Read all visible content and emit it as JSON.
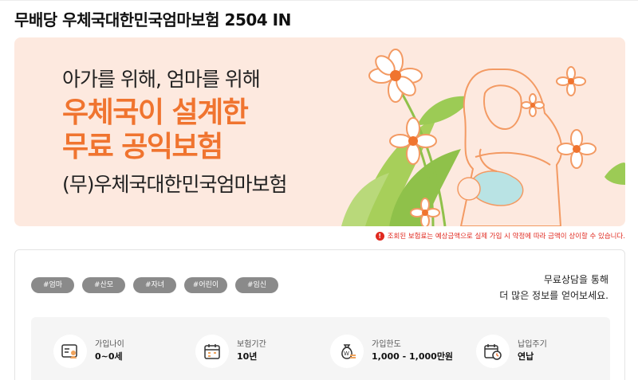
{
  "page": {
    "title": "무배당 우체국대한민국엄마보험 2504 IN"
  },
  "banner": {
    "subtitle": "아가를 위해, 엄마를 위해",
    "headline_line1": "우체국이 설계한",
    "headline_line2": "무료 공익보험",
    "product": "(무)우체국대한민국엄마보험",
    "accent_color": "#f0742f",
    "background_color": "#fde9df"
  },
  "notice": {
    "icon": "exclamation-icon",
    "text": "조회된 보험료는 예상금액으로 실제 가입 시 약정에 따라 금액이 상이할 수 있습니다."
  },
  "tags": [
    "#엄마",
    "#산모",
    "#자녀",
    "#어린이",
    "#임신"
  ],
  "consult": {
    "line1": "무료상담을 통해",
    "line2": "더 많은 정보를 얻어보세요."
  },
  "stats": [
    {
      "icon": "id-card-icon",
      "label": "가입나이",
      "value": "0~0세"
    },
    {
      "icon": "calendar-icon",
      "label": "보험기간",
      "value": "10년"
    },
    {
      "icon": "money-bag-icon",
      "label": "가입한도",
      "value": "1,000 - 1,000만원"
    },
    {
      "icon": "calendar-clock-icon",
      "label": "납입주기",
      "value": "연납"
    }
  ]
}
